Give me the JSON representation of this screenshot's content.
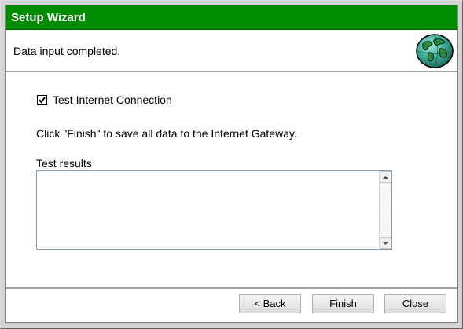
{
  "window": {
    "title": "Setup Wizard"
  },
  "header": {
    "status": "Data input completed.",
    "icon": "globe-icon"
  },
  "content": {
    "test_connection": {
      "label": "Test Internet Connection",
      "checked": true
    },
    "instruction": "Click \"Finish\" to save all data to the Internet Gateway.",
    "results_label": "Test results",
    "results_value": ""
  },
  "footer": {
    "back_label": "< Back",
    "finish_label": "Finish",
    "close_label": "Close"
  },
  "colors": {
    "titlebar": "#008c00",
    "title_text": "#ffffff"
  }
}
